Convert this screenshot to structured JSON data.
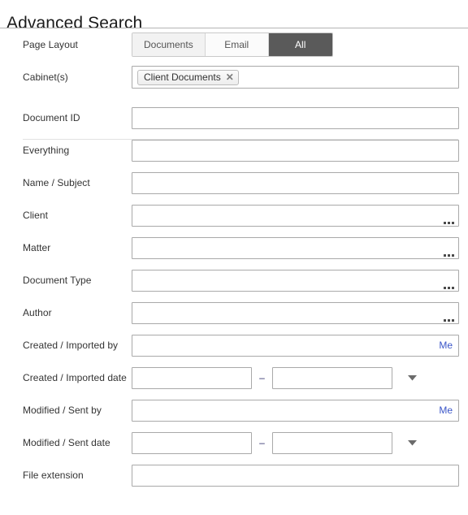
{
  "header": {
    "title": "Advanced Search"
  },
  "page_layout": {
    "label": "Page Layout",
    "tabs": [
      {
        "label": "Documents",
        "active": false
      },
      {
        "label": "Email",
        "active": false
      },
      {
        "label": "All",
        "active": true
      }
    ]
  },
  "cabinets": {
    "label": "Cabinet(s)",
    "value": "",
    "placeholder": "",
    "chips": [
      {
        "label": "Client Documents",
        "remove_icon": "close-icon"
      }
    ]
  },
  "fields": {
    "document_id": {
      "label": "Document ID",
      "value": "",
      "placeholder": ""
    },
    "everything": {
      "label": "Everything",
      "value": "",
      "placeholder": ""
    },
    "name_subject": {
      "label": "Name / Subject",
      "value": "",
      "placeholder": ""
    },
    "client": {
      "label": "Client",
      "value": "",
      "placeholder": "",
      "picker_icon": "ellipsis-icon"
    },
    "matter": {
      "label": "Matter",
      "value": "",
      "placeholder": "",
      "picker_icon": "ellipsis-icon"
    },
    "document_type": {
      "label": "Document Type",
      "value": "",
      "placeholder": "",
      "picker_icon": "ellipsis-icon"
    },
    "author": {
      "label": "Author",
      "value": "",
      "placeholder": "",
      "picker_icon": "ellipsis-icon"
    },
    "created_imported_by": {
      "label": "Created / Imported by",
      "value": "",
      "placeholder": "",
      "me_link": "Me"
    },
    "created_imported_date": {
      "label": "Created / Imported date",
      "from_value": "",
      "from_placeholder": "",
      "to_value": "",
      "to_placeholder": "",
      "separator": "–",
      "dropdown_icon": "chevron-down-icon"
    },
    "modified_sent_by": {
      "label": "Modified / Sent by",
      "value": "",
      "placeholder": "",
      "me_link": "Me"
    },
    "modified_sent_date": {
      "label": "Modified / Sent date",
      "from_value": "",
      "from_placeholder": "",
      "to_value": "",
      "to_placeholder": "",
      "separator": "–",
      "dropdown_icon": "chevron-down-icon"
    },
    "file_extension": {
      "label": "File extension",
      "value": "",
      "placeholder": ""
    }
  },
  "colors": {
    "active_tab_bg": "#5a5a5a",
    "link": "#3a55c8",
    "input_border": "#a9a9a9",
    "rule": "#b5b5b5"
  }
}
